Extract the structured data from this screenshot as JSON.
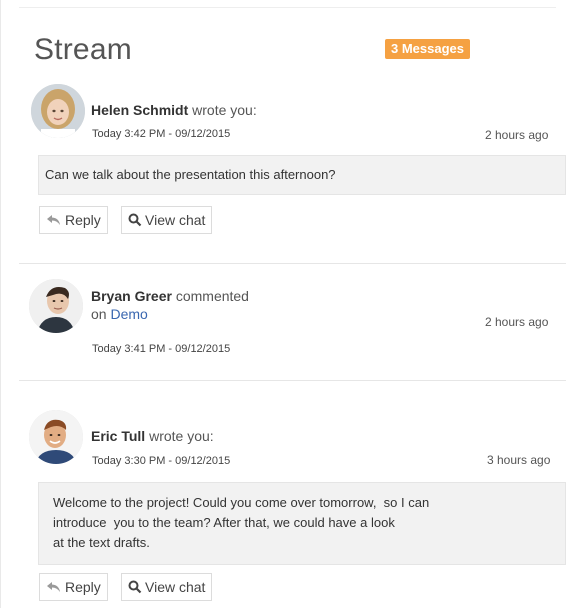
{
  "stream": {
    "title": "Stream",
    "badge": "3 Messages",
    "badge_color": "#f5a142",
    "items": [
      {
        "author": "Helen Schmidt",
        "action": "wrote you:",
        "datetime": "Today 3:42 PM - 09/12/2015",
        "ago": "2 hours ago",
        "message": "Can we talk about the presentation this afternoon?",
        "reply_label": "Reply",
        "view_chat_label": "View chat"
      },
      {
        "author": "Bryan Greer",
        "action": "commented",
        "on_text": "on",
        "link_text": "Demo",
        "datetime": "Today 3:41 PM - 09/12/2015",
        "ago": "2 hours ago"
      },
      {
        "author": "Eric Tull",
        "action": "wrote you:",
        "datetime": "Today 3:30 PM - 09/12/2015",
        "ago": "3 hours ago",
        "message_lines": [
          "Welcome to the project! Could you come over tomorrow,  so I can",
          "introduce  you to the team? After that, we could have a look",
          "at the text drafts."
        ],
        "reply_label": "Reply",
        "view_chat_label": "View chat"
      }
    ]
  }
}
